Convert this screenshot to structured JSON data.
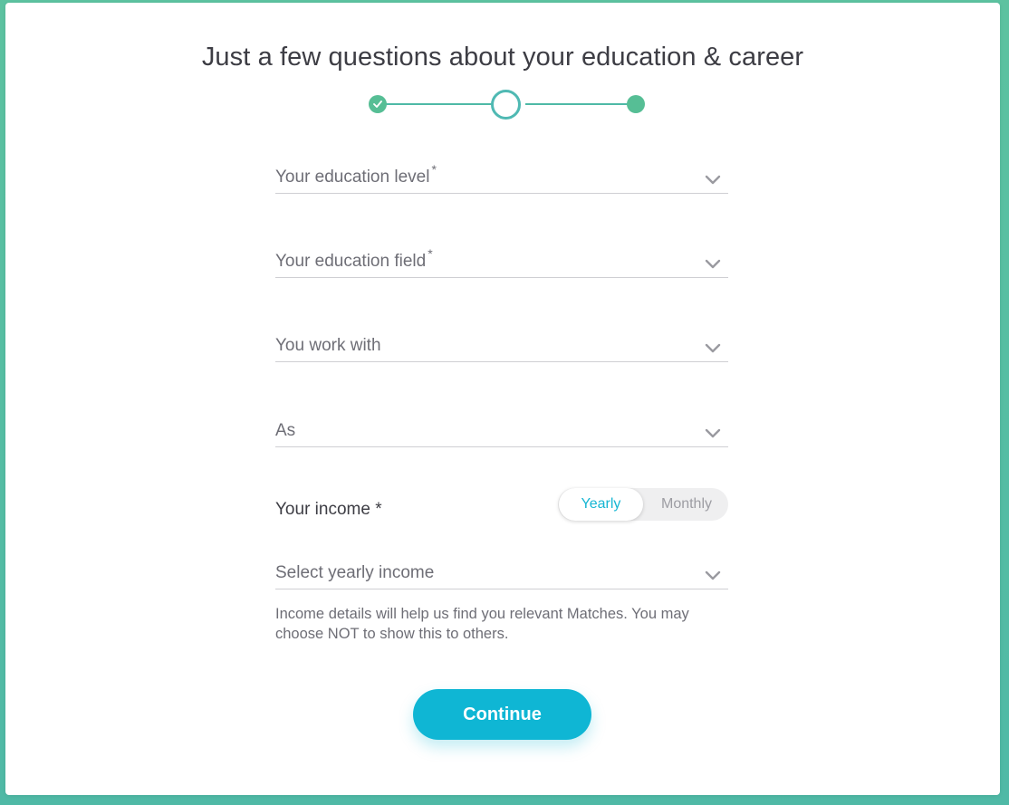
{
  "header": {
    "title": "Just a few questions about your education & career"
  },
  "stepper": {
    "total_steps": 3,
    "current_step": 2,
    "completed_steps": 1
  },
  "form": {
    "education_level": {
      "label": "Your education level",
      "required_mark": "*"
    },
    "education_field": {
      "label": "Your education field",
      "required_mark": "*"
    },
    "work_with": {
      "label": "You work with"
    },
    "work_as": {
      "label": "As"
    },
    "income": {
      "label": "Your income *",
      "toggle": {
        "options": [
          "Yearly",
          "Monthly"
        ],
        "selected": "Yearly"
      },
      "select_label": "Select yearly income",
      "helper_text": "Income details will help us find you relevant Matches. You may choose NOT to show this to others."
    }
  },
  "actions": {
    "continue_label": "Continue"
  },
  "colors": {
    "accent": "#0fb6d4",
    "step_green": "#56be95",
    "background": "#5cc2a0"
  },
  "icons": {
    "step_done": "check-icon",
    "select": "chevron-down-icon"
  }
}
